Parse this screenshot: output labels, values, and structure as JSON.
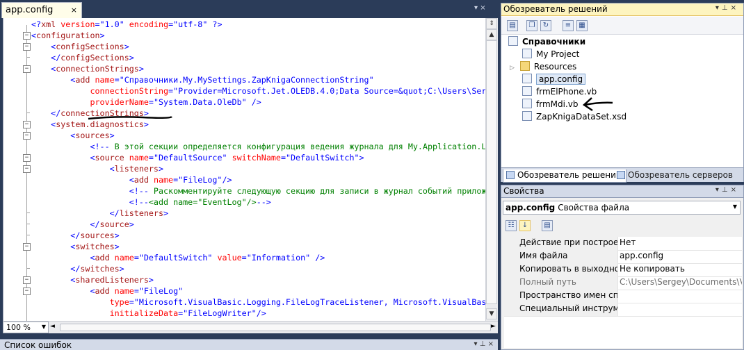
{
  "editor": {
    "tab_label": "app.config",
    "tab_close": "×",
    "tab_controls": "▾ ×",
    "zoom": "100 %",
    "lines": [
      [
        [
          "br",
          "<?"
        ],
        [
          "tag",
          "xml"
        ],
        [
          "attr",
          " version"
        ],
        [
          "br",
          "="
        ],
        [
          "val",
          "\"1.0\""
        ],
        [
          "attr",
          " encoding"
        ],
        [
          "br",
          "="
        ],
        [
          "val",
          "\"utf-8\""
        ],
        [
          "br",
          " ?>"
        ]
      ],
      [
        [
          "br",
          "<"
        ],
        [
          "tag",
          "configuration"
        ],
        [
          "br",
          ">"
        ]
      ],
      [
        [
          "sp",
          "    "
        ],
        [
          "br",
          "<"
        ],
        [
          "tag",
          "configSections"
        ],
        [
          "br",
          ">"
        ]
      ],
      [
        [
          "sp",
          "    "
        ],
        [
          "br",
          "</"
        ],
        [
          "tag",
          "configSections"
        ],
        [
          "br",
          ">"
        ]
      ],
      [
        [
          "sp",
          "    "
        ],
        [
          "br",
          "<"
        ],
        [
          "tag",
          "connectionStrings"
        ],
        [
          "br",
          ">"
        ]
      ],
      [
        [
          "sp",
          "        "
        ],
        [
          "br",
          "<"
        ],
        [
          "tag",
          "add"
        ],
        [
          "attr",
          " name"
        ],
        [
          "br",
          "="
        ],
        [
          "val",
          "\"Справочники.My.MySettings.ZapKnigaConnectionString\""
        ]
      ],
      [
        [
          "sp",
          "            "
        ],
        [
          "attr",
          "connectionString"
        ],
        [
          "br",
          "="
        ],
        [
          "val",
          "\"Provider=Microsoft.Jet.OLEDB.4.0;Data Source=&quot;C:\\Users\\Sergey\\Documents\\Visual"
        ]
      ],
      [
        [
          "sp",
          "            "
        ],
        [
          "attr",
          "providerName"
        ],
        [
          "br",
          "="
        ],
        [
          "val",
          "\"System.Data.OleDb\""
        ],
        [
          "br",
          " />"
        ]
      ],
      [
        [
          "sp",
          "    "
        ],
        [
          "br",
          "</"
        ],
        [
          "tag",
          "connectionStrings"
        ],
        [
          "br",
          ">"
        ]
      ],
      [
        [
          "sp",
          "    "
        ],
        [
          "br",
          "<"
        ],
        [
          "tag",
          "system.diagnostics"
        ],
        [
          "br",
          ">"
        ]
      ],
      [
        [
          "sp",
          "        "
        ],
        [
          "br",
          "<"
        ],
        [
          "tag",
          "sources"
        ],
        [
          "br",
          ">"
        ]
      ],
      [
        [
          "sp",
          "            "
        ],
        [
          "br",
          "<!--"
        ],
        [
          "cmt",
          " В этой секции определяется конфигурация ведения журнала для My.Application.Log "
        ],
        [
          "br",
          ""
        ]
      ],
      [
        [
          "sp",
          "            "
        ],
        [
          "br",
          "<"
        ],
        [
          "tag",
          "source"
        ],
        [
          "attr",
          " name"
        ],
        [
          "br",
          "="
        ],
        [
          "val",
          "\"DefaultSource\""
        ],
        [
          "attr",
          " switchName"
        ],
        [
          "br",
          "="
        ],
        [
          "val",
          "\"DefaultSwitch\""
        ],
        [
          "br",
          ">"
        ]
      ],
      [
        [
          "sp",
          "                "
        ],
        [
          "br",
          "<"
        ],
        [
          "tag",
          "listeners"
        ],
        [
          "br",
          ">"
        ]
      ],
      [
        [
          "sp",
          "                    "
        ],
        [
          "br",
          "<"
        ],
        [
          "tag",
          "add"
        ],
        [
          "attr",
          " name"
        ],
        [
          "br",
          "="
        ],
        [
          "val",
          "\"FileLog\""
        ],
        [
          "br",
          "/>"
        ]
      ],
      [
        [
          "sp",
          "                    "
        ],
        [
          "br",
          "<!--"
        ],
        [
          "cmt",
          " Раскомментируйте следующую секцию для записи в журнал событий приложения "
        ],
        [
          "br",
          ""
        ]
      ],
      [
        [
          "sp",
          "                    "
        ],
        [
          "br",
          "<!--"
        ],
        [
          "cmt",
          "<add name=\"EventLog\"/>"
        ],
        [
          "br",
          "-->"
        ]
      ],
      [
        [
          "sp",
          "                "
        ],
        [
          "br",
          "</"
        ],
        [
          "tag",
          "listeners"
        ],
        [
          "br",
          ">"
        ]
      ],
      [
        [
          "sp",
          "            "
        ],
        [
          "br",
          "</"
        ],
        [
          "tag",
          "source"
        ],
        [
          "br",
          ">"
        ]
      ],
      [
        [
          "sp",
          "        "
        ],
        [
          "br",
          "</"
        ],
        [
          "tag",
          "sources"
        ],
        [
          "br",
          ">"
        ]
      ],
      [
        [
          "sp",
          "        "
        ],
        [
          "br",
          "<"
        ],
        [
          "tag",
          "switches"
        ],
        [
          "br",
          ">"
        ]
      ],
      [
        [
          "sp",
          "            "
        ],
        [
          "br",
          "<"
        ],
        [
          "tag",
          "add"
        ],
        [
          "attr",
          " name"
        ],
        [
          "br",
          "="
        ],
        [
          "val",
          "\"DefaultSwitch\""
        ],
        [
          "attr",
          " value"
        ],
        [
          "br",
          "="
        ],
        [
          "val",
          "\"Information\""
        ],
        [
          "br",
          " />"
        ]
      ],
      [
        [
          "sp",
          "        "
        ],
        [
          "br",
          "</"
        ],
        [
          "tag",
          "switches"
        ],
        [
          "br",
          ">"
        ]
      ],
      [
        [
          "sp",
          "        "
        ],
        [
          "br",
          "<"
        ],
        [
          "tag",
          "sharedListeners"
        ],
        [
          "br",
          ">"
        ]
      ],
      [
        [
          "sp",
          "            "
        ],
        [
          "br",
          "<"
        ],
        [
          "tag",
          "add"
        ],
        [
          "attr",
          " name"
        ],
        [
          "br",
          "="
        ],
        [
          "val",
          "\"FileLog\""
        ]
      ],
      [
        [
          "sp",
          "                "
        ],
        [
          "attr",
          "type"
        ],
        [
          "br",
          "="
        ],
        [
          "val",
          "\"Microsoft.VisualBasic.Logging.FileLogTraceListener, Microsoft.VisualBasic, Version"
        ]
      ],
      [
        [
          "sp",
          "                "
        ],
        [
          "attr",
          "initializeData"
        ],
        [
          "br",
          "="
        ],
        [
          "val",
          "\"FileLogWriter\""
        ],
        [
          "br",
          "/>"
        ]
      ]
    ]
  },
  "error_panel": {
    "title": "Список ошибок",
    "pins": "▾ ⊥ ×"
  },
  "solution_explorer": {
    "title": "Обозреватель решений",
    "pins": "▾⊥×",
    "project": "Справочники",
    "items": [
      "My Project",
      "Resources",
      "app.config",
      "frmElPhone.vb",
      "frmMdi.vb",
      "ZapKnigaDataSet.xsd"
    ],
    "tabs": [
      "Обозреватель решений",
      "Обозреватель серверов"
    ]
  },
  "properties": {
    "title": "Свойства",
    "pins": "▾⊥×",
    "object_name": "app.config",
    "object_type": "Свойства файла",
    "rows": [
      {
        "name": "Действие при построении",
        "value": "Нет"
      },
      {
        "name": "Имя файла",
        "value": "app.config"
      },
      {
        "name": "Копировать в выходной каталог",
        "value": "Не копировать"
      },
      {
        "name": "Полный путь",
        "value": "C:\\Users\\Sergey\\Documents\\Visual"
      },
      {
        "name": "Пространство имен специального средства",
        "value": ""
      },
      {
        "name": "Специальный инструмент",
        "value": ""
      }
    ]
  },
  "colors": {
    "tag": "#a31515",
    "attr": "#ff0000",
    "value": "#0000ff",
    "comment": "#008000",
    "ide_bg": "#2b3c59"
  }
}
